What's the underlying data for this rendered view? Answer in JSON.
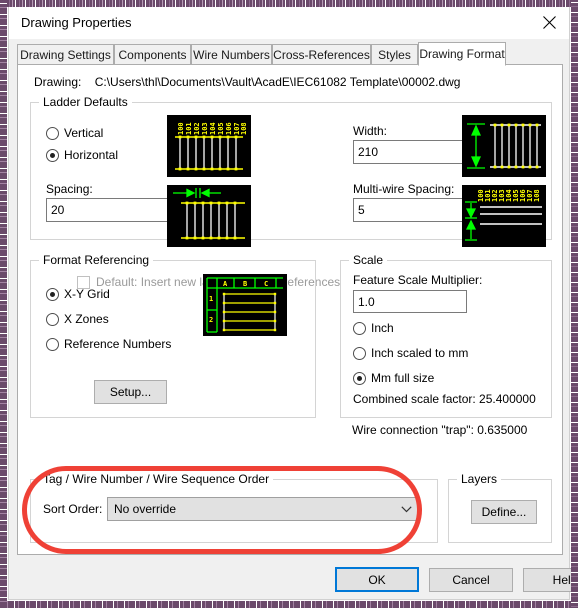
{
  "window": {
    "title": "Drawing Properties",
    "close_icon": "close-icon"
  },
  "tabs": [
    {
      "label": "Drawing Settings",
      "active": false
    },
    {
      "label": "Components",
      "active": false
    },
    {
      "label": "Wire Numbers",
      "active": false
    },
    {
      "label": "Cross-References",
      "active": false
    },
    {
      "label": "Styles",
      "active": false
    },
    {
      "label": "Drawing Format",
      "active": true
    }
  ],
  "drawing": {
    "label": "Drawing:",
    "path": "C:\\Users\\thl\\Documents\\Vault\\AcadE\\IEC61082 Template\\00002.dwg"
  },
  "ladder_defaults": {
    "legend": "Ladder Defaults",
    "orientation_options": [
      {
        "label": "Vertical",
        "selected": false
      },
      {
        "label": "Horizontal",
        "selected": true
      }
    ],
    "spacing_label": "Spacing:",
    "spacing_value": "20",
    "width_label": "Width:",
    "width_value": "210",
    "multiwire_label": "Multi-wire Spacing:",
    "multiwire_value": "5",
    "default_checkbox": {
      "label": "Default: Insert new ladders without references",
      "checked": false,
      "disabled": true
    },
    "preview_ladder_numbers": [
      "100",
      "101",
      "102",
      "103",
      "104",
      "105",
      "106",
      "107",
      "108"
    ],
    "preview_multiwire_numbers": [
      "100",
      "101",
      "102",
      "103",
      "104",
      "105",
      "106",
      "107",
      "108"
    ]
  },
  "format_referencing": {
    "legend": "Format Referencing",
    "options": [
      {
        "label": "X-Y Grid",
        "selected": true
      },
      {
        "label": "X Zones",
        "selected": false
      },
      {
        "label": "Reference Numbers",
        "selected": false
      }
    ],
    "setup_button": "Setup...",
    "preview_columns": [
      "A",
      "B",
      "C"
    ],
    "preview_rows": [
      "1",
      "2"
    ]
  },
  "scale": {
    "legend": "Scale",
    "feature_scale_label": "Feature Scale Multiplier:",
    "feature_scale_value": "1.0",
    "options": [
      {
        "label": "Inch",
        "selected": false
      },
      {
        "label": "Inch scaled to mm",
        "selected": false
      },
      {
        "label": "Mm full size",
        "selected": true
      }
    ],
    "combined_scale_factor": "Combined scale factor: 25.400000",
    "wire_connection_trap": "Wire connection \"trap\": 0.635000"
  },
  "sort_order_group": {
    "legend": "Tag / Wire Number / Wire Sequence Order",
    "sort_order_label": "Sort Order:",
    "sort_order_value": "No override",
    "dropdown_icon": "chevron-down-icon"
  },
  "layers": {
    "legend": "Layers",
    "define_button": "Define..."
  },
  "footer": {
    "ok": "OK",
    "cancel": "Cancel",
    "help": "Help"
  },
  "colors": {
    "accent": "#0078d7",
    "highlight": "#ef4136",
    "preview_bg": "#000000",
    "preview_wire": "#ffffff",
    "preview_text": "#ffff00",
    "preview_arrow": "#00ff00"
  }
}
